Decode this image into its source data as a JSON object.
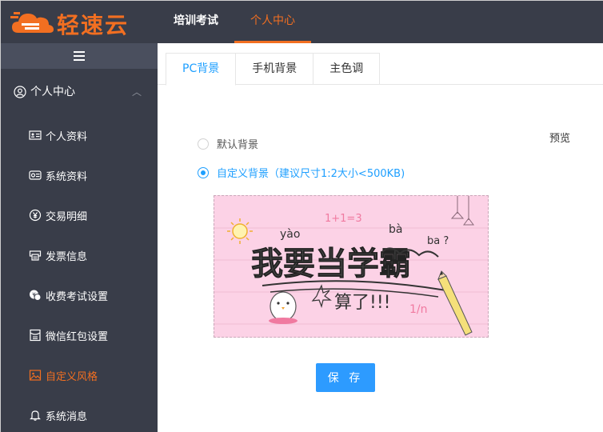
{
  "brand": {
    "name": "轻速云",
    "color": "#f26f21"
  },
  "top_nav": [
    {
      "label": "培训考试",
      "active": false
    },
    {
      "label": "个人中心",
      "active": true
    }
  ],
  "sidebar": {
    "toggle_icon": "hamburger-icon",
    "group": {
      "label": "个人中心",
      "icon": "user-circle-icon",
      "expanded": true
    },
    "items": [
      {
        "label": "个人资料",
        "icon": "id-card-icon"
      },
      {
        "label": "系统资料",
        "icon": "eye-card-icon"
      },
      {
        "label": "交易明细",
        "icon": "yen-icon"
      },
      {
        "label": "发票信息",
        "icon": "printer-icon"
      },
      {
        "label": "收费考试设置",
        "icon": "coins-icon"
      },
      {
        "label": "微信红包设置",
        "icon": "redpacket-icon"
      },
      {
        "label": "自定义风格",
        "icon": "image-icon",
        "active": true
      },
      {
        "label": "系统消息",
        "icon": "bell-icon"
      }
    ]
  },
  "tabs": [
    {
      "label": "PC背景",
      "active": true
    },
    {
      "label": "手机背景",
      "active": false
    },
    {
      "label": "主色调",
      "active": false
    }
  ],
  "preview_label": "预览",
  "background_options": [
    {
      "label": "默认背景",
      "checked": false
    },
    {
      "label": "自定义背景（建议尺寸1:2大小<500KB)",
      "checked": true
    }
  ],
  "background_image": {
    "main_text": "我要当学霸",
    "pinyin": [
      "yào",
      "bà",
      "ba ?"
    ],
    "formula": "1+1=3",
    "sub_text": "算了!!!",
    "fraction": "1/n",
    "bg_color": "#fcd2e6"
  },
  "save_label": "保 存",
  "accent_color": "#1e9fff"
}
